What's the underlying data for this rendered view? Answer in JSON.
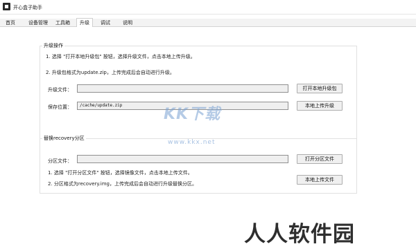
{
  "window": {
    "title": "开心盒子助手"
  },
  "tabs": [
    {
      "label": "首页",
      "active": false
    },
    {
      "label": "设备管理",
      "active": false
    },
    {
      "label": "工具箱",
      "active": false
    },
    {
      "label": "升级",
      "active": true
    },
    {
      "label": "调试",
      "active": false
    },
    {
      "label": "说明",
      "active": false
    }
  ],
  "upgrade": {
    "group_title": "升级操作",
    "instruction_1": "1. 选择 \"打开本地升级包\" 按钮，选择升级文件，点击本地上传升级。",
    "instruction_2": "2. 升级包格式为update.zip，上传完成后会自动进行升级。",
    "file_label": "升级文件：",
    "file_value": "",
    "open_button": "打开本地升级包",
    "save_label": "保存位置：",
    "save_value": "/cache/update.zip",
    "upload_button": "本地上传升级"
  },
  "recovery": {
    "group_title": "替换recovery分区",
    "partition_label": "分区文件：",
    "partition_value": "",
    "open_button": "打开分区文件",
    "instruction_1": "1. 选择 \"打开分区文件\" 按钮，选择镜像文件，点击本地上传文件。",
    "instruction_2": "2. 分区格式为recovery.img，上传完成后会自动进行升级替换分区。",
    "upload_button": "本地上传文件"
  },
  "watermarks": {
    "center_text": "KK下载",
    "center_url": "www.kkx.net",
    "corner_text": "人人软件园"
  }
}
